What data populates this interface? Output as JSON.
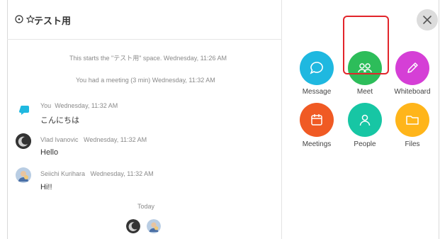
{
  "header": {
    "space_title": "テスト用"
  },
  "system_messages": [
    "This starts the \"テスト用\" space. Wednesday, 11:26 AM",
    "You had a meeting (3 min) Wednesday, 11:32 AM"
  ],
  "messages": [
    {
      "sender": "You",
      "time": "Wednesday, 11:32 AM",
      "text": "こんにちは"
    },
    {
      "sender": "Vlad Ivanovic",
      "time": "Wednesday, 11:32 AM",
      "text": "Hello"
    },
    {
      "sender": "Seiichi Kurihara",
      "time": "Wednesday, 11:32 AM",
      "text": "Hi!!"
    }
  ],
  "divider_label": "Today",
  "actions": [
    {
      "label": "Message",
      "color": "#1fb8e0",
      "icon": "chat-bubble-icon"
    },
    {
      "label": "Meet",
      "color": "#2dbd5a",
      "icon": "people-group-icon"
    },
    {
      "label": "Whiteboard",
      "color": "#d53fd6",
      "icon": "pencil-icon"
    },
    {
      "label": "Meetings",
      "color": "#f05a24",
      "icon": "calendar-icon"
    },
    {
      "label": "People",
      "color": "#17c6a4",
      "icon": "person-icon"
    },
    {
      "label": "Files",
      "color": "#ffb51a",
      "icon": "folder-icon"
    }
  ],
  "close_icon": "close-icon",
  "highlight_color": "#e2252b"
}
